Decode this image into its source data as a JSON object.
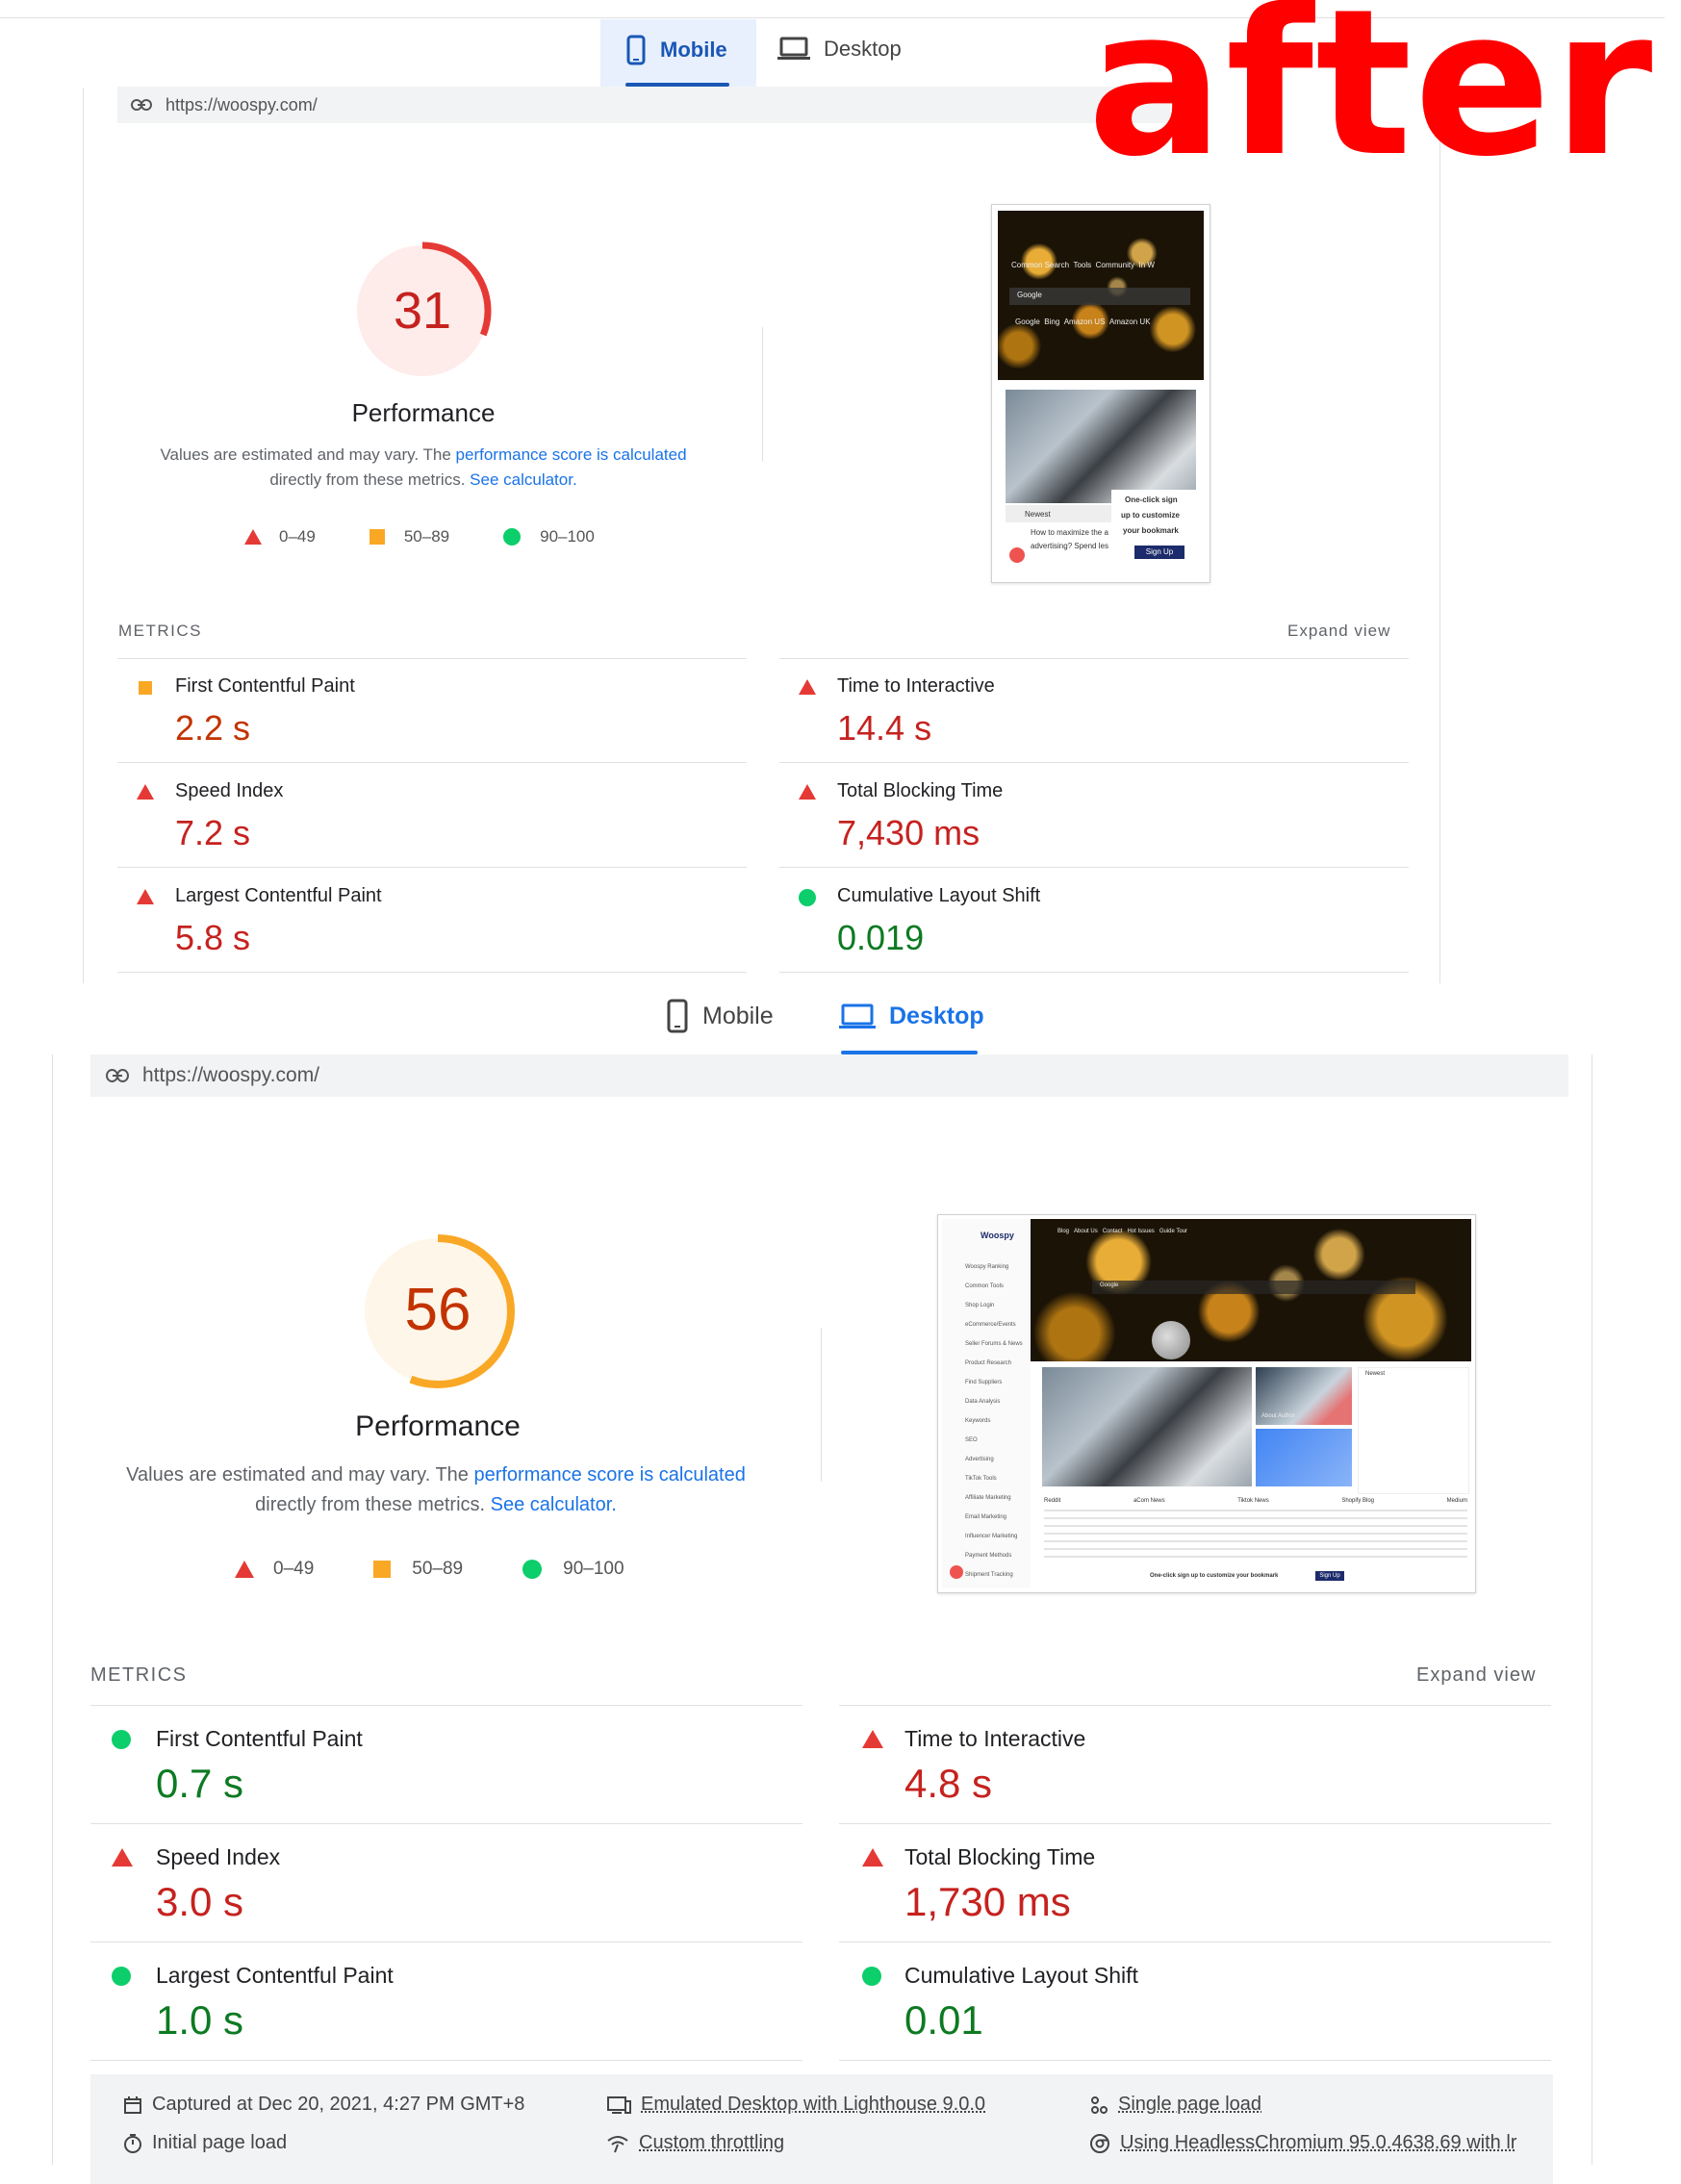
{
  "top": {
    "tabs": [
      {
        "label": "Mobile",
        "icon": "phone-icon",
        "active": true
      },
      {
        "label": "Desktop",
        "icon": "laptop-icon",
        "active": false
      }
    ],
    "url": "https://woospy.com/",
    "overlay_text": "after",
    "score": "31",
    "score_fraction": 0.31,
    "perf_title": "Performance",
    "desc_prefix": "Values are estimated and may vary. The ",
    "desc_link1": "performance score is calculated",
    "desc_mid": "directly from these metrics. ",
    "desc_link2": "See calculator.",
    "legend": [
      "0–49",
      "50–89",
      "90–100"
    ],
    "metrics_title": "METRICS",
    "expand": "Expand view",
    "metrics": [
      {
        "label": "First Contentful Paint",
        "value": "2.2 s",
        "status": "average"
      },
      {
        "label": "Time to Interactive",
        "value": "14.4 s",
        "status": "fail"
      },
      {
        "label": "Speed Index",
        "value": "7.2 s",
        "status": "fail"
      },
      {
        "label": "Total Blocking Time",
        "value": "7,430 ms",
        "status": "fail"
      },
      {
        "label": "Largest Contentful Paint",
        "value": "5.8 s",
        "status": "fail"
      },
      {
        "label": "Cumulative Layout Shift",
        "value": "0.019",
        "status": "pass"
      }
    ],
    "thumb": {
      "nav": [
        "Common Search",
        "Tools",
        "Community",
        "In W"
      ],
      "search_placeholder": "Google",
      "engines": [
        "Google",
        "Bing",
        "Amazon US",
        "Amazon UK"
      ],
      "newest": "Newest",
      "item1": "How to maximize the a",
      "item2": "advertising? Spend les",
      "signup_text": [
        "One-click sign",
        "up to customize",
        "your bookmark"
      ],
      "signup_btn": "Sign Up"
    }
  },
  "bottom": {
    "tabs": [
      {
        "label": "Mobile",
        "icon": "phone-icon",
        "active": false
      },
      {
        "label": "Desktop",
        "icon": "laptop-icon",
        "active": true
      }
    ],
    "url": "https://woospy.com/",
    "score": "56",
    "score_fraction": 0.56,
    "perf_title": "Performance",
    "desc_prefix": "Values are estimated and may vary. The ",
    "desc_link1": "performance score is calculated",
    "desc_mid": "directly from these metrics. ",
    "desc_link2": "See calculator.",
    "legend": [
      "0–49",
      "50–89",
      "90–100"
    ],
    "metrics_title": "METRICS",
    "expand": "Expand view",
    "metrics": [
      {
        "label": "First Contentful Paint",
        "value": "0.7 s",
        "status": "pass"
      },
      {
        "label": "Time to Interactive",
        "value": "4.8 s",
        "status": "fail"
      },
      {
        "label": "Speed Index",
        "value": "3.0 s",
        "status": "fail"
      },
      {
        "label": "Total Blocking Time",
        "value": "1,730 ms",
        "status": "fail"
      },
      {
        "label": "Largest Contentful Paint",
        "value": "1.0 s",
        "status": "pass"
      },
      {
        "label": "Cumulative Layout Shift",
        "value": "0.01",
        "status": "pass"
      }
    ],
    "thumb": {
      "logo": "Woospy",
      "top_nav": [
        "Blog",
        "About Us",
        "Contact",
        "Hot Issues",
        "Guide Tour"
      ],
      "sidebar": [
        "Woospy Ranking",
        "Common Tools",
        "Shop Login",
        "eCommerce/Events",
        "Seller Forums & News",
        "Product Research",
        "Find Suppliers",
        "Data Analysis",
        "Keywords",
        "SEO",
        "Advertising",
        "TikTok Tools",
        "Affiliate Marketing",
        "Email Marketing",
        "Influencer Marketing",
        "Payment Methods",
        "Shipment Tracking"
      ],
      "search_placeholder": "Google",
      "newest": "Newest",
      "cards": [
        "Reddit",
        "aCom News",
        "Tiktok News",
        "Shopify Blog",
        "Medium"
      ],
      "bottom_text": "One-click sign up to customize your bookmark",
      "signup_btn": "Sign Up",
      "about_author": "About Author"
    },
    "footer": [
      {
        "icon": "calendar-icon",
        "text": "Captured at Dec 20, 2021, 4:27 PM GMT+8",
        "link": false
      },
      {
        "icon": "desktop-icon",
        "text": "Emulated Desktop with Lighthouse 9.0.0",
        "link": true
      },
      {
        "icon": "nodes-icon",
        "text": "Single page load",
        "link": true
      },
      {
        "icon": "timer-icon",
        "text": "Initial page load",
        "link": false
      },
      {
        "icon": "wifi-icon",
        "text": "Custom throttling",
        "link": true
      },
      {
        "icon": "chromium-icon",
        "text": "Using HeadlessChromium 95.0.4638.69 with lr",
        "link": true
      }
    ]
  },
  "colors": {
    "fail": "#e53935",
    "average": "#f9a825",
    "pass": "#0cce6b",
    "link": "#1a73e8"
  }
}
